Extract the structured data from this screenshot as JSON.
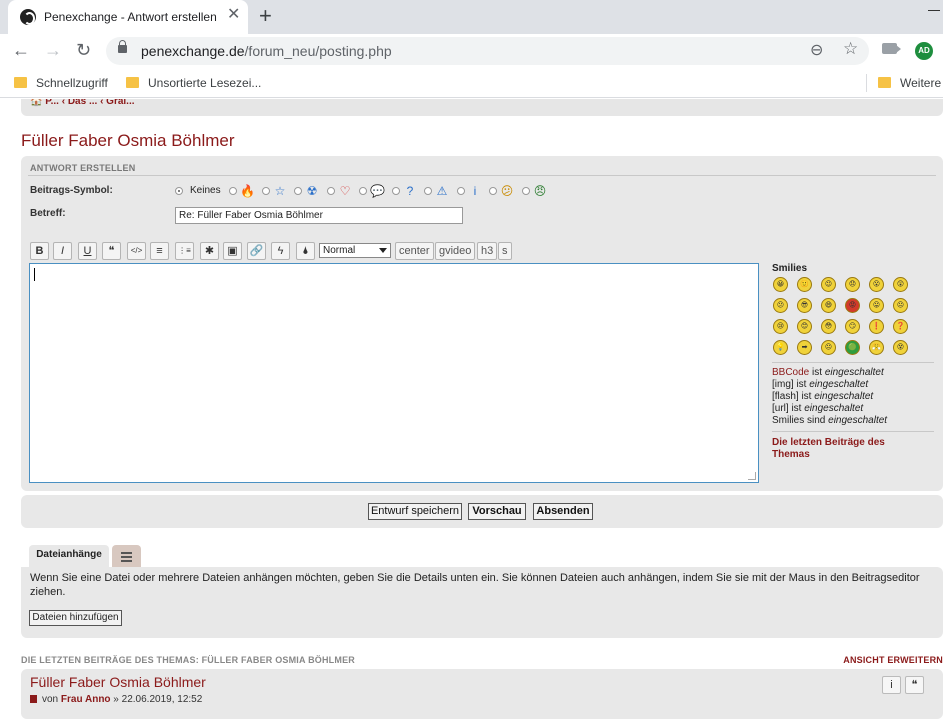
{
  "browser": {
    "tab_title": "Penexchange - Antwort erstellen",
    "url_host": "penexchange.de",
    "url_path": "/forum_neu/posting.php",
    "avatar_initials": "AD",
    "bookmarks": [
      "Schnellzugriff",
      "Unsortierte Lesezei..."
    ],
    "other_bookmarks": "Weitere"
  },
  "breadcrumb": "🏠 P... ‹ Das ... ‹ Grai...",
  "page_title": "Füller Faber Osmia Böhlmer",
  "reply_form": {
    "heading": "ANTWORT ERSTELLEN",
    "post_icon_label": "Beitrags-Symbol:",
    "post_icon_none": "Keines",
    "post_icons": [
      {
        "glyph": "🔥",
        "color": "#d9531e"
      },
      {
        "glyph": "☆",
        "color": "#2a6fc9"
      },
      {
        "glyph": "☢",
        "color": "#2a6fc9"
      },
      {
        "glyph": "♡",
        "color": "#d02020"
      },
      {
        "glyph": "💬",
        "color": "#2a6fc9"
      },
      {
        "glyph": "?",
        "color": "#2a6fc9"
      },
      {
        "glyph": "⚠",
        "color": "#2a6fc9"
      },
      {
        "glyph": "i",
        "color": "#2a6fc9"
      },
      {
        "glyph": "😕",
        "color": "#c88a00"
      },
      {
        "glyph": "😠",
        "color": "#2e7d32"
      }
    ],
    "subject_label": "Betreff:",
    "subject_value": "Re: Füller Faber Osmia Böhlmer"
  },
  "format_toolbar": {
    "buttons": [
      "B",
      "I",
      "U",
      "❝",
      "</>",
      "≡",
      "⋮≡",
      "✱",
      "▣",
      "🔗",
      "ϟ",
      "🌢"
    ],
    "font_size": "Normal",
    "custom_tags": [
      "center",
      "gvideo",
      "h3",
      "s"
    ]
  },
  "smilies": {
    "title": "Smilies",
    "faces": [
      "😀",
      "🙂",
      "😉",
      "😞",
      "😮",
      "😲",
      "😕",
      "😎",
      "😄",
      "😡",
      "😛",
      "😐",
      "😢",
      "😊",
      "😳",
      "😏",
      "❗",
      "❓",
      "💡",
      "➡",
      "😐",
      "🟢",
      "😤",
      "😵"
    ]
  },
  "status": {
    "bbcode_link": "BBCode",
    "bbcode_rest": " ist ",
    "img_prefix": "[img] ist ",
    "flash_prefix": "[flash] ist ",
    "url_prefix": "[url] ist ",
    "smilies_prefix": "Smilies sind ",
    "enabled": "eingeschaltet",
    "recent_posts_link": "Die letzten Beiträge des Themas"
  },
  "actions": {
    "save_draft": "Entwurf speichern",
    "preview": "Vorschau",
    "submit": "Absenden"
  },
  "attachments": {
    "tab_label": "Dateianhänge",
    "help_text": "Wenn Sie eine Datei oder mehrere Dateien anhängen möchten, geben Sie die Details unten ein. Sie können Dateien auch anhängen, indem Sie sie mit der Maus in den Beitragseditor ziehen.",
    "add_files": "Dateien hinzufügen"
  },
  "recent": {
    "heading": "DIE LETZTEN BEITRÄGE DES THEMAS: FÜLLER FABER OSMIA BÖHLMER",
    "expand": "ANSICHT ERWEITERN",
    "post_title": "Füller Faber Osmia Böhlmer",
    "by": "von ",
    "author": "Frau Anno",
    "date": " » 22.06.2019, 12:52",
    "info_btn": "i",
    "quote_btn": "❝"
  }
}
